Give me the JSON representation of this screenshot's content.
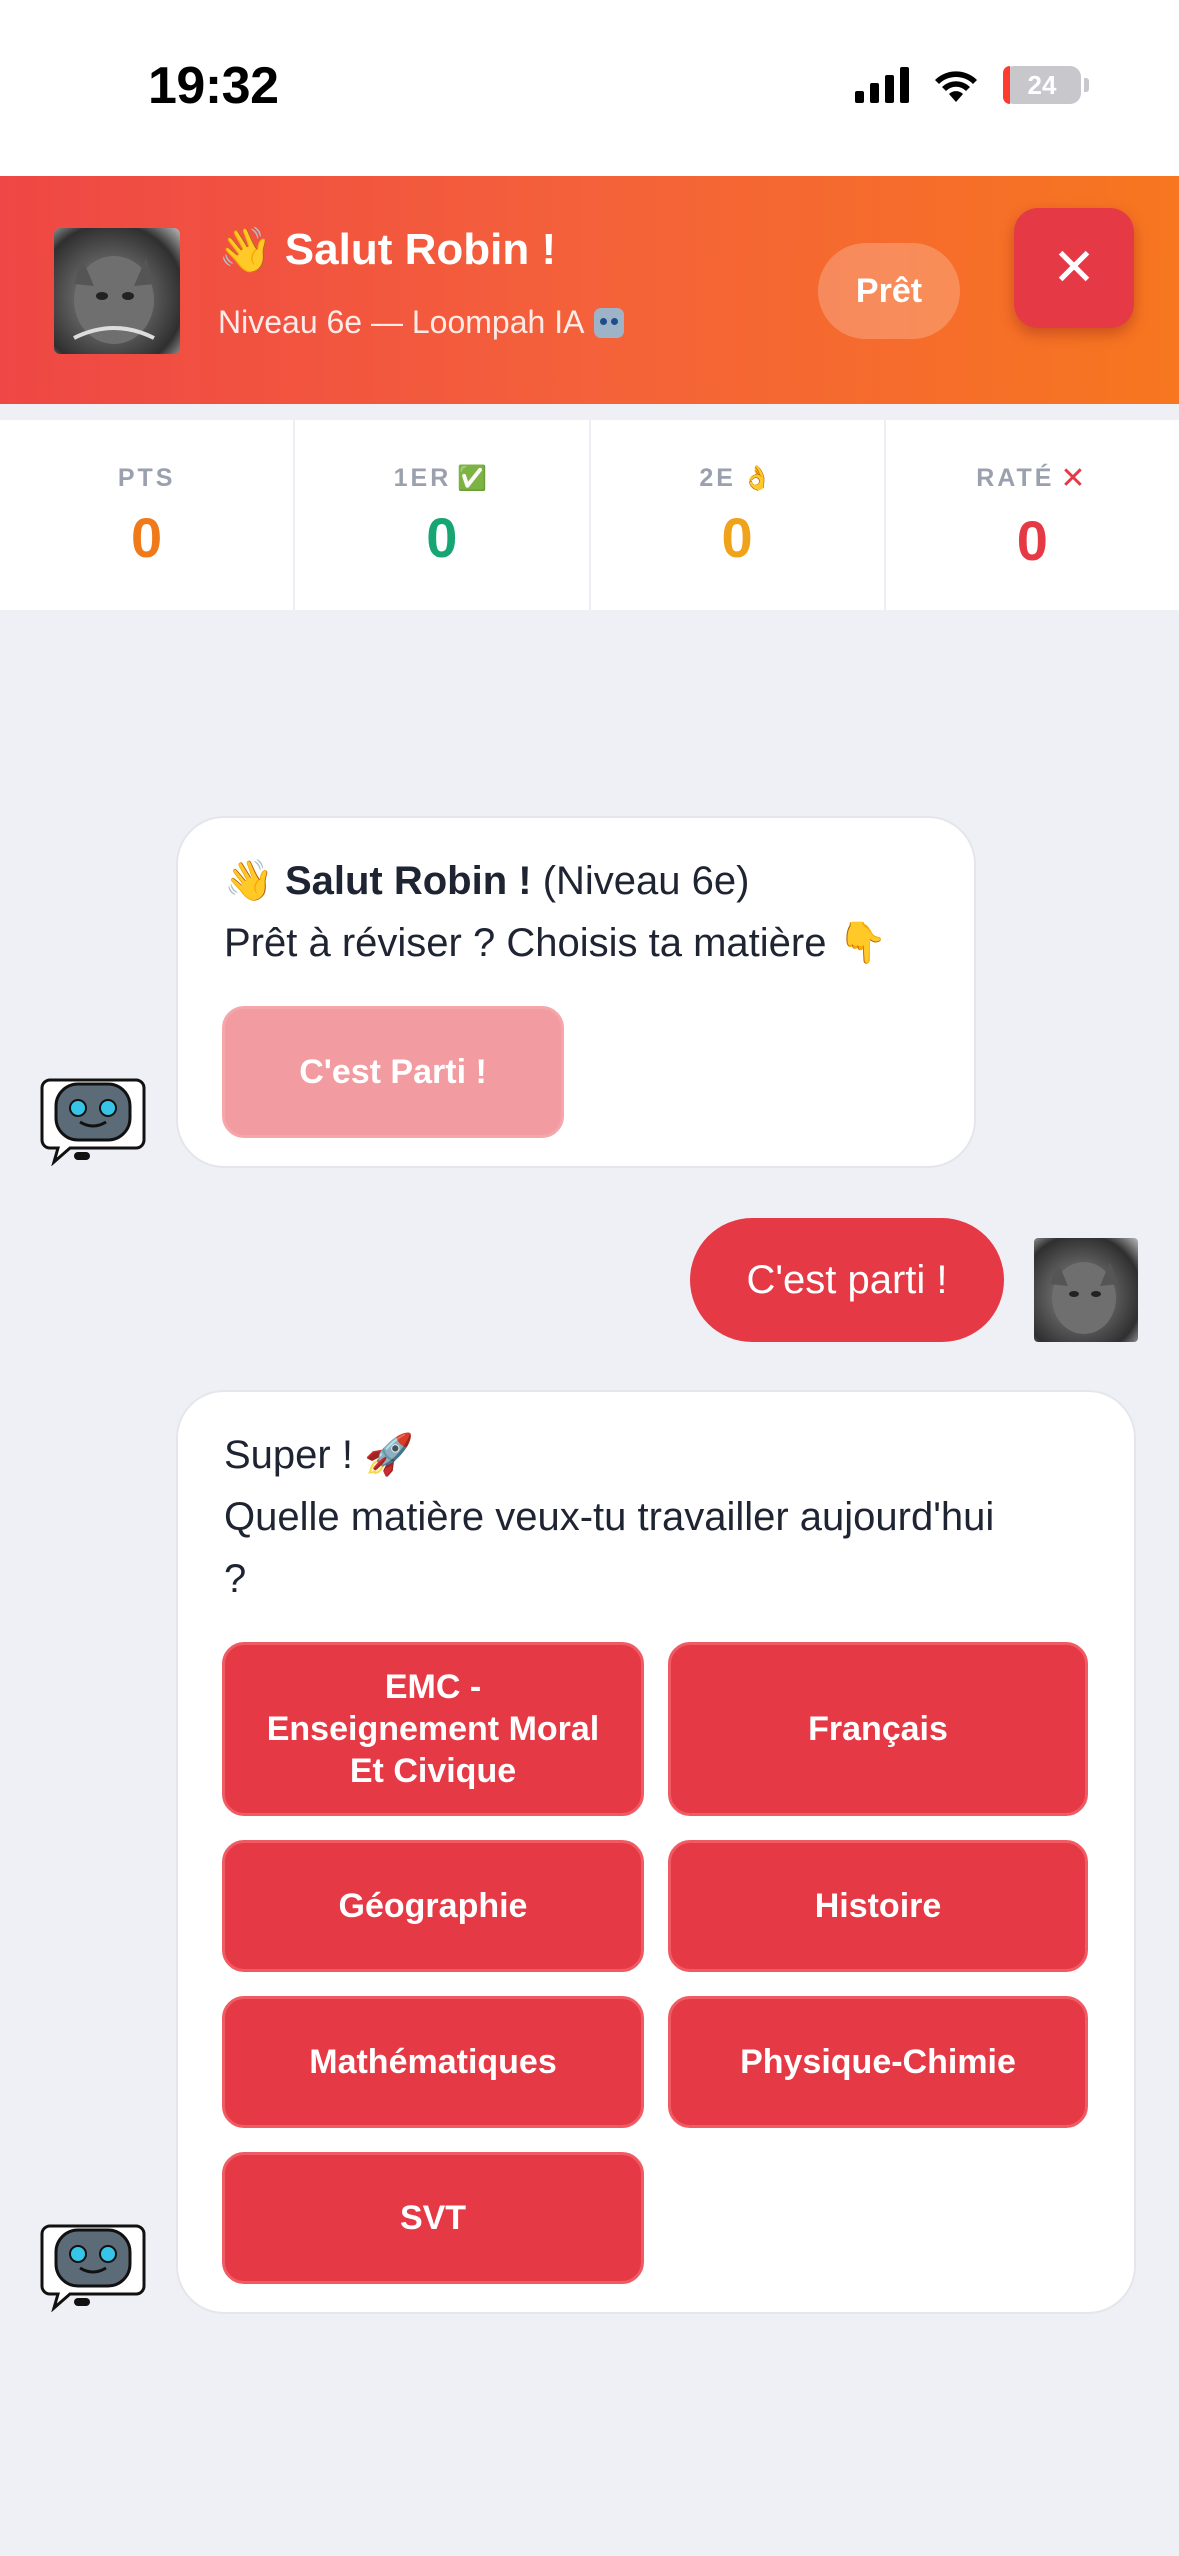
{
  "status_bar": {
    "time": "19:32",
    "battery": "24",
    "icons": [
      "signal-icon",
      "wifi-icon",
      "battery-icon"
    ]
  },
  "header": {
    "wave_emoji": "👋",
    "title": "Salut Robin !",
    "subtitle": "Niveau 6e — Loompah IA",
    "ready_label": "Prêt",
    "close_label": "✕",
    "colors": {
      "gradient_start": "#ef4745",
      "gradient_end": "#f7761f",
      "close_bg": "#e63946"
    }
  },
  "stats": [
    {
      "label": "PTS",
      "emoji": "",
      "value": "0",
      "color": "#f07a1a"
    },
    {
      "label": "1ER",
      "emoji": "✅",
      "value": "0",
      "color": "#17a673"
    },
    {
      "label": "2E",
      "emoji": "👌",
      "value": "0",
      "color": "#f0a21a"
    },
    {
      "label": "RATÉ",
      "emoji": "✕",
      "value": "0",
      "color": "#e63946"
    }
  ],
  "chat": {
    "bot_msg1": {
      "wave": "👋",
      "bold": "Salut Robin !",
      "level": " (Niveau 6e)",
      "line2": "Prêt à réviser ? Choisis ta matière",
      "line2_emoji": "👇",
      "button": "C'est Parti !"
    },
    "user_msg": "C'est parti !",
    "bot_msg2": {
      "line1": "Super !",
      "line1_emoji": "🚀",
      "line2": "Quelle matière veux-tu travailler aujourd'hui",
      "line3": "?",
      "subjects": [
        "EMC - Enseignement Moral Et Civique",
        "Français",
        "Géographie",
        "Histoire",
        "Mathématiques",
        "Physique-Chimie",
        "SVT"
      ]
    }
  },
  "accent_color": "#e63946"
}
